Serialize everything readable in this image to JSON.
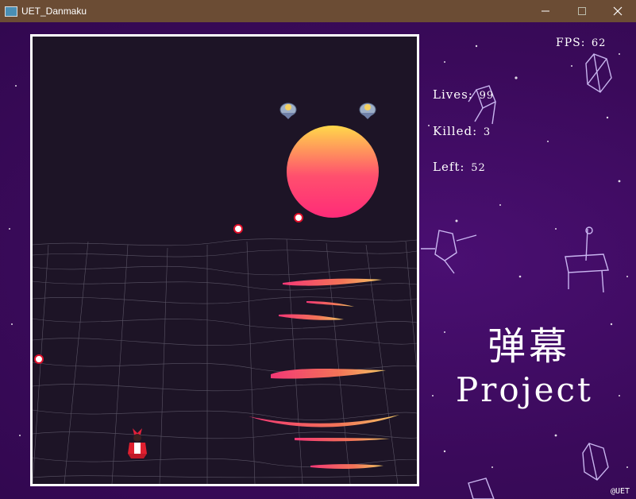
{
  "window": {
    "title": "UET_Danmaku",
    "controls": {
      "minimize": "—",
      "maximize": "☐",
      "close": "✕"
    }
  },
  "hud": {
    "fps_label": "FPS:",
    "fps_value": "62",
    "lives_label": "Lives:",
    "lives_value": "99",
    "killed_label": "Killed:",
    "killed_value": "3",
    "left_label": "Left:",
    "left_value": "52"
  },
  "logo": {
    "cn": "弹幕",
    "en": "Project"
  },
  "credit": "@UET",
  "colors": {
    "titlebar": "#6b4c34",
    "background": "#3b0a5c",
    "playfield": "#1d1426",
    "sun_top": "#ffd84a",
    "sun_bottom": "#ff2e7a",
    "border": "#ffffff"
  },
  "sprites": {
    "player": "shrine-maiden-sprite",
    "enemy": "fairy-sprite",
    "bullet": "round-bullet"
  }
}
